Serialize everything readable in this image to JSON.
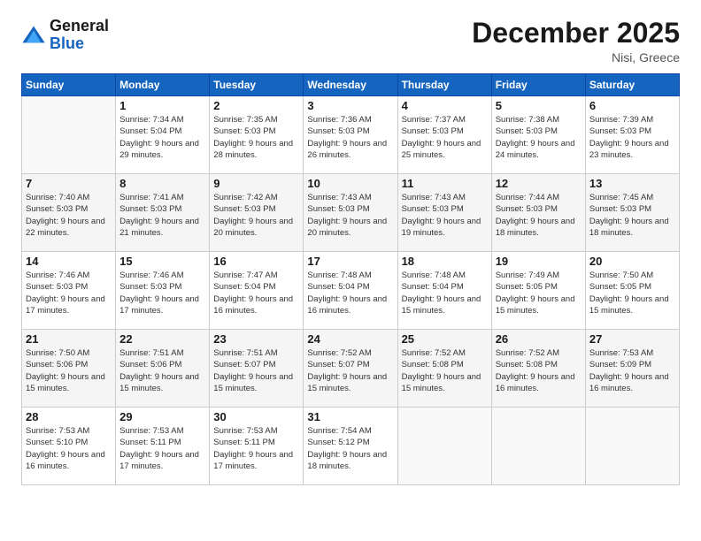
{
  "header": {
    "logo_general": "General",
    "logo_blue": "Blue",
    "month_title": "December 2025",
    "location": "Nisi, Greece"
  },
  "weekdays": [
    "Sunday",
    "Monday",
    "Tuesday",
    "Wednesday",
    "Thursday",
    "Friday",
    "Saturday"
  ],
  "weeks": [
    [
      {
        "day": "",
        "sunrise": "",
        "sunset": "",
        "daylight": ""
      },
      {
        "day": "1",
        "sunrise": "Sunrise: 7:34 AM",
        "sunset": "Sunset: 5:04 PM",
        "daylight": "Daylight: 9 hours and 29 minutes."
      },
      {
        "day": "2",
        "sunrise": "Sunrise: 7:35 AM",
        "sunset": "Sunset: 5:03 PM",
        "daylight": "Daylight: 9 hours and 28 minutes."
      },
      {
        "day": "3",
        "sunrise": "Sunrise: 7:36 AM",
        "sunset": "Sunset: 5:03 PM",
        "daylight": "Daylight: 9 hours and 26 minutes."
      },
      {
        "day": "4",
        "sunrise": "Sunrise: 7:37 AM",
        "sunset": "Sunset: 5:03 PM",
        "daylight": "Daylight: 9 hours and 25 minutes."
      },
      {
        "day": "5",
        "sunrise": "Sunrise: 7:38 AM",
        "sunset": "Sunset: 5:03 PM",
        "daylight": "Daylight: 9 hours and 24 minutes."
      },
      {
        "day": "6",
        "sunrise": "Sunrise: 7:39 AM",
        "sunset": "Sunset: 5:03 PM",
        "daylight": "Daylight: 9 hours and 23 minutes."
      }
    ],
    [
      {
        "day": "7",
        "sunrise": "Sunrise: 7:40 AM",
        "sunset": "Sunset: 5:03 PM",
        "daylight": "Daylight: 9 hours and 22 minutes."
      },
      {
        "day": "8",
        "sunrise": "Sunrise: 7:41 AM",
        "sunset": "Sunset: 5:03 PM",
        "daylight": "Daylight: 9 hours and 21 minutes."
      },
      {
        "day": "9",
        "sunrise": "Sunrise: 7:42 AM",
        "sunset": "Sunset: 5:03 PM",
        "daylight": "Daylight: 9 hours and 20 minutes."
      },
      {
        "day": "10",
        "sunrise": "Sunrise: 7:43 AM",
        "sunset": "Sunset: 5:03 PM",
        "daylight": "Daylight: 9 hours and 20 minutes."
      },
      {
        "day": "11",
        "sunrise": "Sunrise: 7:43 AM",
        "sunset": "Sunset: 5:03 PM",
        "daylight": "Daylight: 9 hours and 19 minutes."
      },
      {
        "day": "12",
        "sunrise": "Sunrise: 7:44 AM",
        "sunset": "Sunset: 5:03 PM",
        "daylight": "Daylight: 9 hours and 18 minutes."
      },
      {
        "day": "13",
        "sunrise": "Sunrise: 7:45 AM",
        "sunset": "Sunset: 5:03 PM",
        "daylight": "Daylight: 9 hours and 18 minutes."
      }
    ],
    [
      {
        "day": "14",
        "sunrise": "Sunrise: 7:46 AM",
        "sunset": "Sunset: 5:03 PM",
        "daylight": "Daylight: 9 hours and 17 minutes."
      },
      {
        "day": "15",
        "sunrise": "Sunrise: 7:46 AM",
        "sunset": "Sunset: 5:03 PM",
        "daylight": "Daylight: 9 hours and 17 minutes."
      },
      {
        "day": "16",
        "sunrise": "Sunrise: 7:47 AM",
        "sunset": "Sunset: 5:04 PM",
        "daylight": "Daylight: 9 hours and 16 minutes."
      },
      {
        "day": "17",
        "sunrise": "Sunrise: 7:48 AM",
        "sunset": "Sunset: 5:04 PM",
        "daylight": "Daylight: 9 hours and 16 minutes."
      },
      {
        "day": "18",
        "sunrise": "Sunrise: 7:48 AM",
        "sunset": "Sunset: 5:04 PM",
        "daylight": "Daylight: 9 hours and 15 minutes."
      },
      {
        "day": "19",
        "sunrise": "Sunrise: 7:49 AM",
        "sunset": "Sunset: 5:05 PM",
        "daylight": "Daylight: 9 hours and 15 minutes."
      },
      {
        "day": "20",
        "sunrise": "Sunrise: 7:50 AM",
        "sunset": "Sunset: 5:05 PM",
        "daylight": "Daylight: 9 hours and 15 minutes."
      }
    ],
    [
      {
        "day": "21",
        "sunrise": "Sunrise: 7:50 AM",
        "sunset": "Sunset: 5:06 PM",
        "daylight": "Daylight: 9 hours and 15 minutes."
      },
      {
        "day": "22",
        "sunrise": "Sunrise: 7:51 AM",
        "sunset": "Sunset: 5:06 PM",
        "daylight": "Daylight: 9 hours and 15 minutes."
      },
      {
        "day": "23",
        "sunrise": "Sunrise: 7:51 AM",
        "sunset": "Sunset: 5:07 PM",
        "daylight": "Daylight: 9 hours and 15 minutes."
      },
      {
        "day": "24",
        "sunrise": "Sunrise: 7:52 AM",
        "sunset": "Sunset: 5:07 PM",
        "daylight": "Daylight: 9 hours and 15 minutes."
      },
      {
        "day": "25",
        "sunrise": "Sunrise: 7:52 AM",
        "sunset": "Sunset: 5:08 PM",
        "daylight": "Daylight: 9 hours and 15 minutes."
      },
      {
        "day": "26",
        "sunrise": "Sunrise: 7:52 AM",
        "sunset": "Sunset: 5:08 PM",
        "daylight": "Daylight: 9 hours and 16 minutes."
      },
      {
        "day": "27",
        "sunrise": "Sunrise: 7:53 AM",
        "sunset": "Sunset: 5:09 PM",
        "daylight": "Daylight: 9 hours and 16 minutes."
      }
    ],
    [
      {
        "day": "28",
        "sunrise": "Sunrise: 7:53 AM",
        "sunset": "Sunset: 5:10 PM",
        "daylight": "Daylight: 9 hours and 16 minutes."
      },
      {
        "day": "29",
        "sunrise": "Sunrise: 7:53 AM",
        "sunset": "Sunset: 5:11 PM",
        "daylight": "Daylight: 9 hours and 17 minutes."
      },
      {
        "day": "30",
        "sunrise": "Sunrise: 7:53 AM",
        "sunset": "Sunset: 5:11 PM",
        "daylight": "Daylight: 9 hours and 17 minutes."
      },
      {
        "day": "31",
        "sunrise": "Sunrise: 7:54 AM",
        "sunset": "Sunset: 5:12 PM",
        "daylight": "Daylight: 9 hours and 18 minutes."
      },
      {
        "day": "",
        "sunrise": "",
        "sunset": "",
        "daylight": ""
      },
      {
        "day": "",
        "sunrise": "",
        "sunset": "",
        "daylight": ""
      },
      {
        "day": "",
        "sunrise": "",
        "sunset": "",
        "daylight": ""
      }
    ]
  ]
}
